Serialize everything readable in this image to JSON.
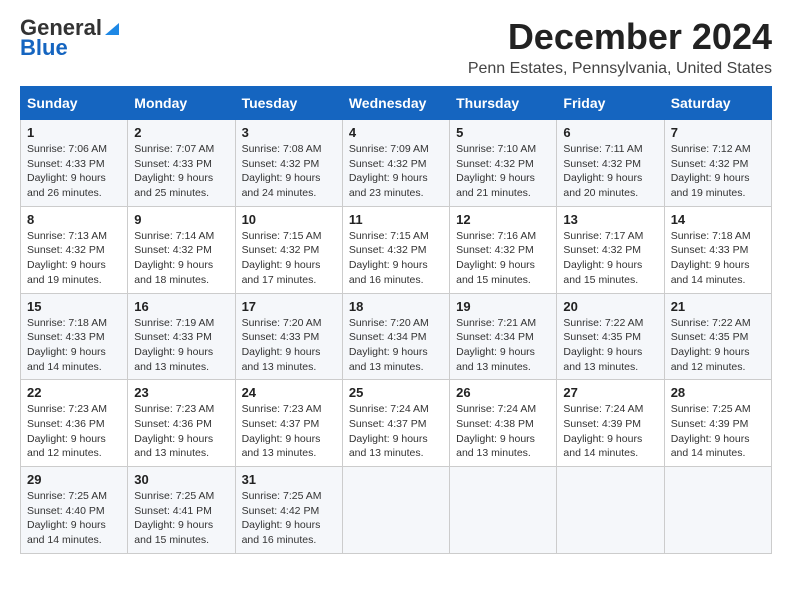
{
  "logo": {
    "general": "General",
    "blue": "Blue"
  },
  "title": "December 2024",
  "subtitle": "Penn Estates, Pennsylvania, United States",
  "days_of_week": [
    "Sunday",
    "Monday",
    "Tuesday",
    "Wednesday",
    "Thursday",
    "Friday",
    "Saturday"
  ],
  "weeks": [
    [
      {
        "day": "1",
        "sunrise": "7:06 AM",
        "sunset": "4:33 PM",
        "daylight": "9 hours and 26 minutes."
      },
      {
        "day": "2",
        "sunrise": "7:07 AM",
        "sunset": "4:33 PM",
        "daylight": "9 hours and 25 minutes."
      },
      {
        "day": "3",
        "sunrise": "7:08 AM",
        "sunset": "4:32 PM",
        "daylight": "9 hours and 24 minutes."
      },
      {
        "day": "4",
        "sunrise": "7:09 AM",
        "sunset": "4:32 PM",
        "daylight": "9 hours and 23 minutes."
      },
      {
        "day": "5",
        "sunrise": "7:10 AM",
        "sunset": "4:32 PM",
        "daylight": "9 hours and 21 minutes."
      },
      {
        "day": "6",
        "sunrise": "7:11 AM",
        "sunset": "4:32 PM",
        "daylight": "9 hours and 20 minutes."
      },
      {
        "day": "7",
        "sunrise": "7:12 AM",
        "sunset": "4:32 PM",
        "daylight": "9 hours and 19 minutes."
      }
    ],
    [
      {
        "day": "8",
        "sunrise": "7:13 AM",
        "sunset": "4:32 PM",
        "daylight": "9 hours and 19 minutes."
      },
      {
        "day": "9",
        "sunrise": "7:14 AM",
        "sunset": "4:32 PM",
        "daylight": "9 hours and 18 minutes."
      },
      {
        "day": "10",
        "sunrise": "7:15 AM",
        "sunset": "4:32 PM",
        "daylight": "9 hours and 17 minutes."
      },
      {
        "day": "11",
        "sunrise": "7:15 AM",
        "sunset": "4:32 PM",
        "daylight": "9 hours and 16 minutes."
      },
      {
        "day": "12",
        "sunrise": "7:16 AM",
        "sunset": "4:32 PM",
        "daylight": "9 hours and 15 minutes."
      },
      {
        "day": "13",
        "sunrise": "7:17 AM",
        "sunset": "4:32 PM",
        "daylight": "9 hours and 15 minutes."
      },
      {
        "day": "14",
        "sunrise": "7:18 AM",
        "sunset": "4:33 PM",
        "daylight": "9 hours and 14 minutes."
      }
    ],
    [
      {
        "day": "15",
        "sunrise": "7:18 AM",
        "sunset": "4:33 PM",
        "daylight": "9 hours and 14 minutes."
      },
      {
        "day": "16",
        "sunrise": "7:19 AM",
        "sunset": "4:33 PM",
        "daylight": "9 hours and 13 minutes."
      },
      {
        "day": "17",
        "sunrise": "7:20 AM",
        "sunset": "4:33 PM",
        "daylight": "9 hours and 13 minutes."
      },
      {
        "day": "18",
        "sunrise": "7:20 AM",
        "sunset": "4:34 PM",
        "daylight": "9 hours and 13 minutes."
      },
      {
        "day": "19",
        "sunrise": "7:21 AM",
        "sunset": "4:34 PM",
        "daylight": "9 hours and 13 minutes."
      },
      {
        "day": "20",
        "sunrise": "7:22 AM",
        "sunset": "4:35 PM",
        "daylight": "9 hours and 13 minutes."
      },
      {
        "day": "21",
        "sunrise": "7:22 AM",
        "sunset": "4:35 PM",
        "daylight": "9 hours and 12 minutes."
      }
    ],
    [
      {
        "day": "22",
        "sunrise": "7:23 AM",
        "sunset": "4:36 PM",
        "daylight": "9 hours and 12 minutes."
      },
      {
        "day": "23",
        "sunrise": "7:23 AM",
        "sunset": "4:36 PM",
        "daylight": "9 hours and 13 minutes."
      },
      {
        "day": "24",
        "sunrise": "7:23 AM",
        "sunset": "4:37 PM",
        "daylight": "9 hours and 13 minutes."
      },
      {
        "day": "25",
        "sunrise": "7:24 AM",
        "sunset": "4:37 PM",
        "daylight": "9 hours and 13 minutes."
      },
      {
        "day": "26",
        "sunrise": "7:24 AM",
        "sunset": "4:38 PM",
        "daylight": "9 hours and 13 minutes."
      },
      {
        "day": "27",
        "sunrise": "7:24 AM",
        "sunset": "4:39 PM",
        "daylight": "9 hours and 14 minutes."
      },
      {
        "day": "28",
        "sunrise": "7:25 AM",
        "sunset": "4:39 PM",
        "daylight": "9 hours and 14 minutes."
      }
    ],
    [
      {
        "day": "29",
        "sunrise": "7:25 AM",
        "sunset": "4:40 PM",
        "daylight": "9 hours and 14 minutes."
      },
      {
        "day": "30",
        "sunrise": "7:25 AM",
        "sunset": "4:41 PM",
        "daylight": "9 hours and 15 minutes."
      },
      {
        "day": "31",
        "sunrise": "7:25 AM",
        "sunset": "4:42 PM",
        "daylight": "9 hours and 16 minutes."
      },
      null,
      null,
      null,
      null
    ]
  ],
  "labels": {
    "sunrise": "Sunrise:",
    "sunset": "Sunset:",
    "daylight": "Daylight:"
  }
}
